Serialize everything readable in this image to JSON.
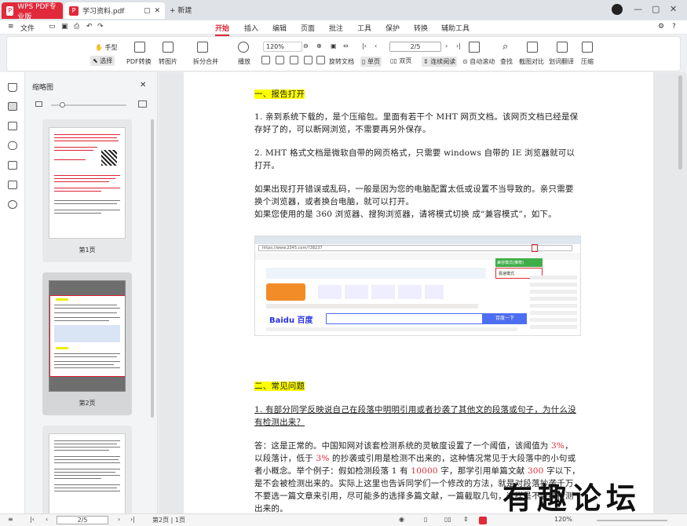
{
  "tabs": {
    "app": "WPS PDF专业版",
    "doc": "学习资料.pdf",
    "new": "+ 新建"
  },
  "menu": {
    "file": "文件",
    "items": [
      "开始",
      "插入",
      "编辑",
      "页面",
      "批注",
      "工具",
      "保护",
      "转换",
      "辅助工具"
    ]
  },
  "toolbar": {
    "hand": "手型",
    "select": "选择",
    "pdf_convert": "PDF转换",
    "convert_img": "转图片",
    "split_merge": "拆分合并",
    "play": "播放",
    "zoom": "120%",
    "page": "2/5",
    "rotate": "旋转文档",
    "single": "单页",
    "double": "双页",
    "continuous": "连续阅读",
    "auto_scroll": "自动滚动",
    "find": "查找",
    "screenshot": "截图对比",
    "translate": "划词翻译",
    "compress": "压缩"
  },
  "thumbs": {
    "title": "缩略图",
    "labels": [
      "第1页",
      "第2页"
    ]
  },
  "doc": {
    "h1": "一、报告打开",
    "p1": "1. 亲到系统下载的，是个压缩包。里面有若干个 MHT 网页文档。该网页文档已经是保存好了的，可以断网浏览，不需要再另外保存。",
    "p2": "2. MHT 格式文档是微软自带的网页格式，只需要 windows 自带的 IE 浏览器就可以打开。",
    "p3": "如果出现打开错误或乱码，一般是因为您的电脑配置太低或设置不当导致的。亲只需要换个浏览器，或者换台电脑，就可以打开。",
    "p4": "如果您使用的是 360 浏览器、搜狗浏览器，请将模式切换 成“兼容模式”，如下。",
    "h2": "二、常见问题",
    "q1": "1. 有部分同学反映说自己在段落中明明引用或者抄袭了其他文的段落或句子，为什么没有检测出来？",
    "a1_start": "答：这是正常的。中国知网对该套检测系统的灵敏度设置了一个阈值，该阈值为 ",
    "a1_pct1": "3%",
    "a1_mid": "，以段落计，低于 ",
    "a1_pct2": "3%",
    "a1_mid2": " 的抄袭或引用是检测不出来的，这种情况常见于大段落中的小句或者小概念。举个例子：假如检测段落 1 有 ",
    "a1_num1": "10000",
    "a1_mid3": " 字，那学引用单篇文献 ",
    "a1_num2": "300",
    "a1_end": " 字以下，是不会被检测出来的。实际上这里也告诉同学们一个修改的方法，就是对段落抄袭千万不要选一篇文章来引用，尽可能多的选择多篇文献，一篇截取几句，这样是不会被检测出来的。"
  },
  "shot": {
    "url": "https://www.2345.com/?38237",
    "baidu": "Baidu 百度",
    "search": "百度一下",
    "menu1": "兼容模式(推荐)",
    "menu2": "极速模式"
  },
  "status": {
    "page": "2/5",
    "nav": "第2页 | 1页",
    "zoom": "120%"
  },
  "watermark": "有趣论坛"
}
